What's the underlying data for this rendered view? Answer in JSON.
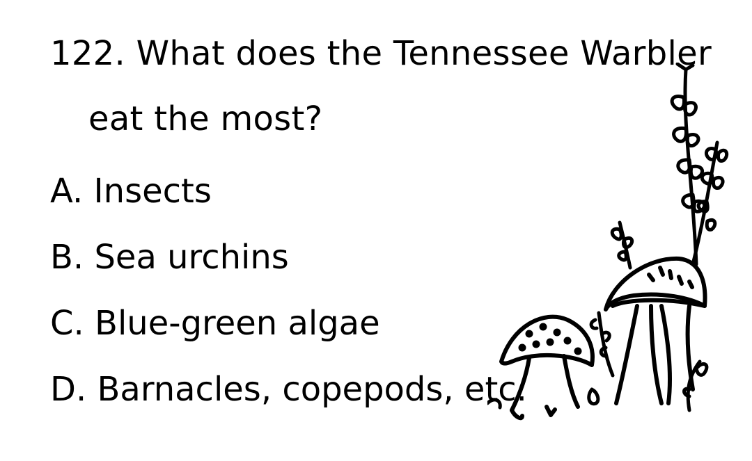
{
  "question": {
    "line1": "122. What does the Tennessee Warbler",
    "line2": "eat the most?"
  },
  "options": [
    "A. Insects",
    "B. Sea urchins",
    "C. Blue-green algae",
    "D. Barnacles, copepods, etc."
  ],
  "illustration": {
    "icon": "mushrooms-and-plants-doodle",
    "stroke_color": "#000000"
  }
}
